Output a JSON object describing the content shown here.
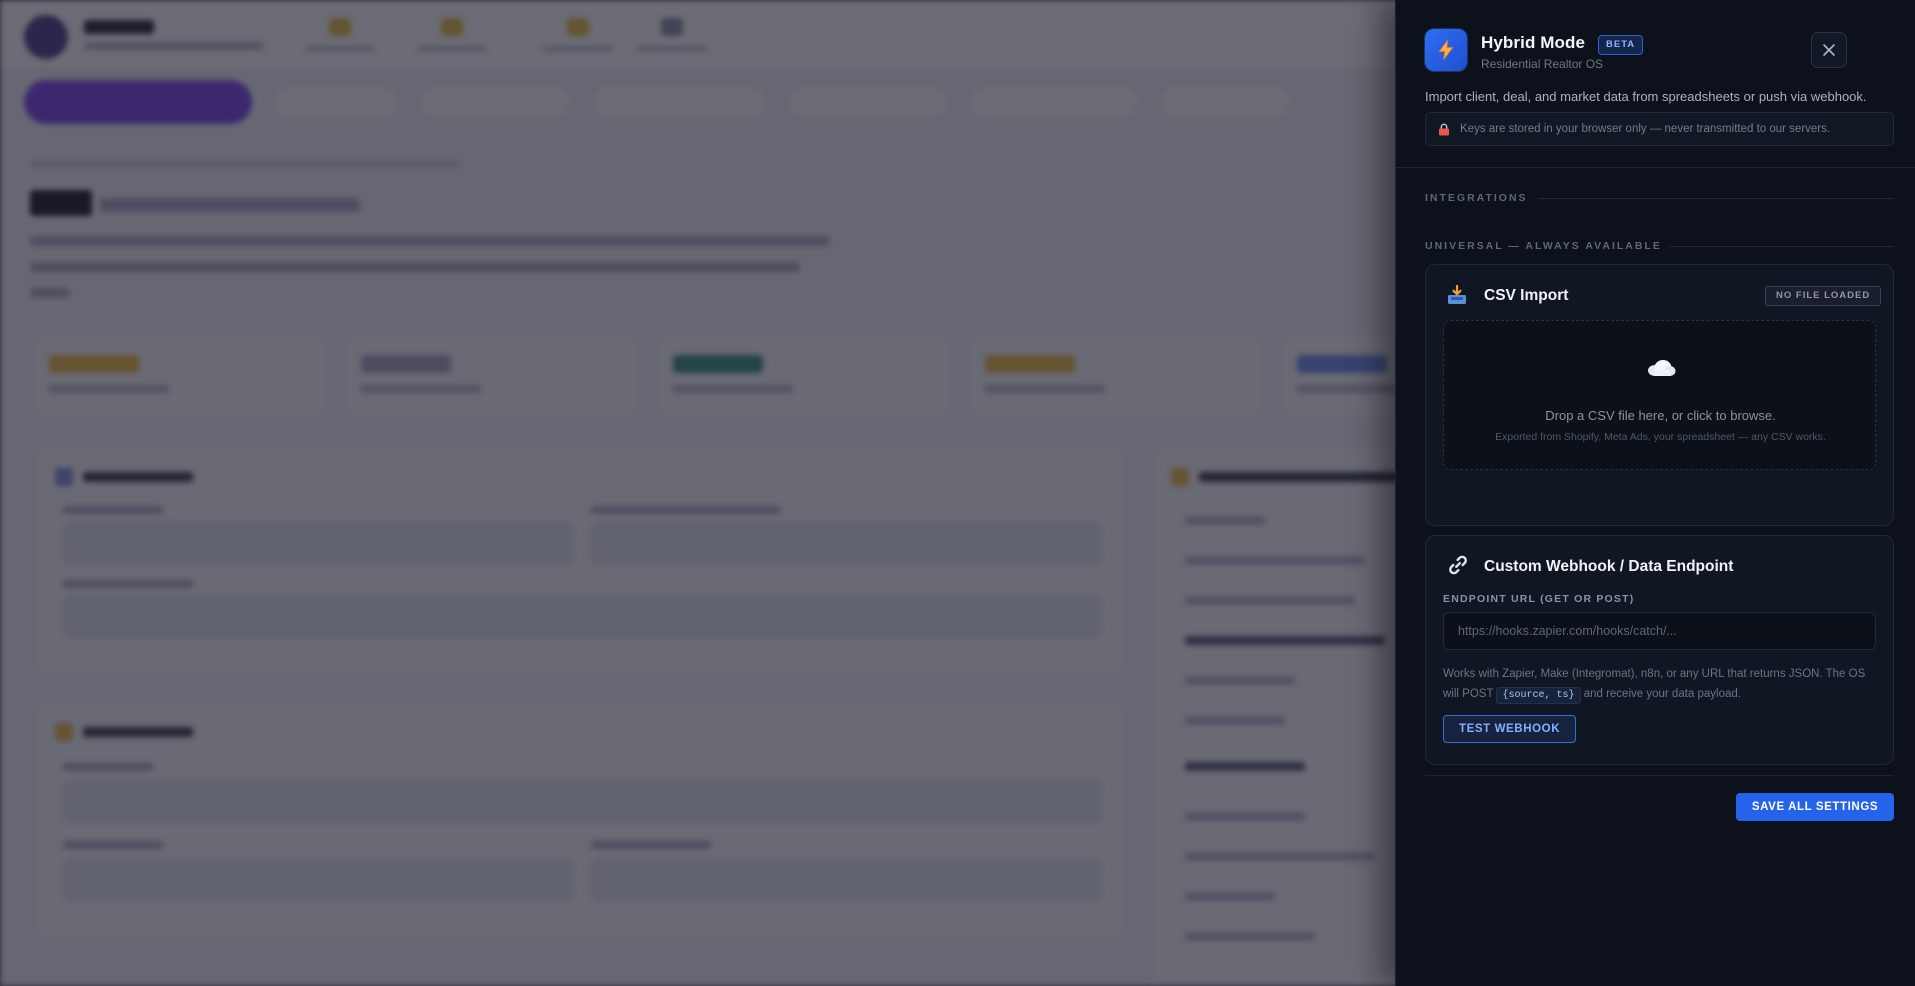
{
  "panel": {
    "title": "Hybrid Mode",
    "badge": "BETA",
    "subtitle": "Residential Realtor OS",
    "description": "Import client, deal, and market data from spreadsheets or push via webhook.",
    "security_notice": "Keys are stored in your browser only — never transmitted to our servers.",
    "icons": {
      "app": "lightning-bolt-icon",
      "close": "close-icon",
      "lock": "lock-icon",
      "csv": "inbox-tray-icon",
      "cloud": "cloud-icon",
      "webhook": "link-icon"
    }
  },
  "sections": {
    "integrations": "INTEGRATIONS",
    "universal": "UNIVERSAL — ALWAYS AVAILABLE"
  },
  "csv_import": {
    "title": "CSV Import",
    "status": "NO FILE LOADED",
    "drop_text": "Drop a CSV file here, or click to browse.",
    "drop_hint": "Exported from Shopify, Meta Ads, your spreadsheet — any CSV works."
  },
  "webhook": {
    "title": "Custom Webhook / Data Endpoint",
    "field_label": "ENDPOINT URL (GET OR POST)",
    "url_value": "",
    "url_placeholder": "https://hooks.zapier.com/hooks/catch/...",
    "help_prefix": "Works with Zapier, Make (Integromat), n8n, or any URL that returns JSON. The OS will POST",
    "help_code": "{source, ts}",
    "help_suffix": "and receive your data payload.",
    "test_button": "TEST WEBHOOK"
  },
  "footer": {
    "save_button": "SAVE ALL SETTINGS"
  },
  "colors": {
    "panel_bg": "#0c111b",
    "accent": "#2563eb",
    "overlay": "rgba(22, 24, 36, 0.62)"
  }
}
